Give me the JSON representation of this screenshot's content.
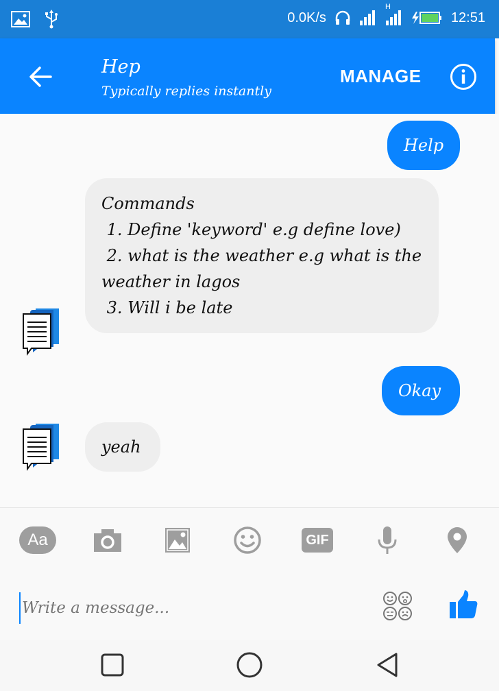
{
  "status_bar": {
    "network_speed": "0.0K/s",
    "time": "12:51",
    "network_type": "H",
    "icons": [
      "image-icon",
      "usb-icon",
      "headset-icon",
      "signal-icon",
      "signal-icon",
      "battery-charging-icon"
    ]
  },
  "header": {
    "title": "Hep",
    "subtitle": "Typically replies instantly",
    "manage_label": "MANAGE",
    "back_icon": "arrow-left-icon",
    "info_icon": "info-icon"
  },
  "messages": [
    {
      "direction": "outgoing",
      "text": "Help"
    },
    {
      "direction": "incoming",
      "text": "Commands\n 1. Define 'keyword' e.g define love)\n 2. what is the weather e.g what is the weather in lagos\n 3. Will i be late"
    },
    {
      "direction": "outgoing",
      "text": "Okay"
    },
    {
      "direction": "incoming",
      "text": "yeah"
    }
  ],
  "toolbar": {
    "text_style_label": "Aa",
    "gif_label": "GIF",
    "icons": [
      "text-style-icon",
      "camera-icon",
      "image-icon",
      "emoji-icon",
      "gif-icon",
      "microphone-icon",
      "location-pin-icon"
    ]
  },
  "composer": {
    "placeholder": "Write a message...",
    "value": ""
  },
  "nav": {
    "icons": [
      "recent-apps-icon",
      "home-icon",
      "back-icon"
    ]
  },
  "colors": {
    "status_bar": "#1a7fd6",
    "app_bar": "#0a84ff",
    "outgoing_bubble": "#0a84ff",
    "incoming_bubble": "#eeeeee",
    "toolbar_icon": "#9e9e9e"
  }
}
